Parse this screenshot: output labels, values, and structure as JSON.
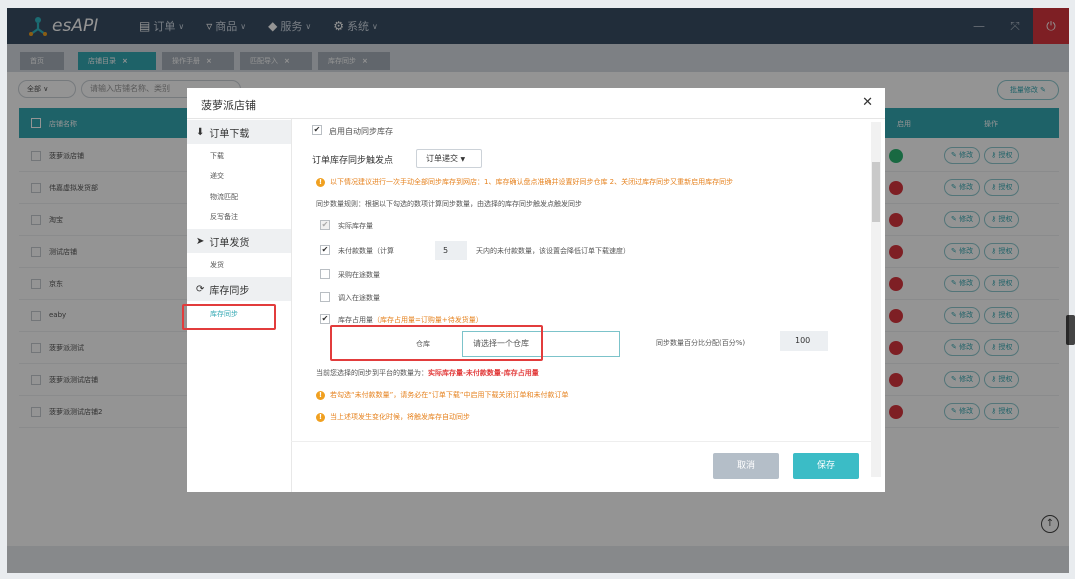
{
  "app": {
    "logo_text": "esAPI"
  },
  "nav": [
    {
      "icon": "clipboard-icon",
      "glyph": "📋",
      "label": "订单"
    },
    {
      "icon": "cart-icon",
      "glyph": "🛒",
      "label": "商品"
    },
    {
      "icon": "shield-icon",
      "glyph": "🛡",
      "label": "服务"
    },
    {
      "icon": "gear-icon",
      "glyph": "⚙",
      "label": "系统"
    }
  ],
  "tabs": [
    {
      "label": "首页",
      "closable": false
    },
    {
      "label": "店铺目录",
      "closable": true,
      "active": true
    },
    {
      "label": "操作手册",
      "closable": true
    },
    {
      "label": "匹配导入",
      "closable": true
    },
    {
      "label": "库存同步",
      "closable": true
    }
  ],
  "filter": {
    "select_value": "全部",
    "search_placeholder": "请输入店铺名称、类别",
    "batch_label": "批量修改"
  },
  "table": {
    "headers": {
      "name": "店铺名称",
      "status": "启用",
      "ops": "操作"
    },
    "rows": [
      {
        "name": "菠萝派店铺",
        "enabled": true
      },
      {
        "name": "伟嘉虚拟发货部",
        "enabled": false
      },
      {
        "name": "淘宝",
        "enabled": false
      },
      {
        "name": "测试店铺",
        "enabled": false
      },
      {
        "name": "京东",
        "enabled": false
      },
      {
        "name": "eaby",
        "enabled": false
      },
      {
        "name": "菠萝派测试",
        "enabled": false
      },
      {
        "name": "菠萝派测试店铺",
        "enabled": false
      },
      {
        "name": "菠萝派测试店铺2",
        "enabled": false
      }
    ],
    "edit_label": "修改",
    "auth_label": "授权"
  },
  "modal": {
    "title": "菠萝派店铺",
    "sections": [
      {
        "icon": "download-icon",
        "glyph": "⬇",
        "label": "订单下载",
        "items": [
          "下载",
          "递交",
          "物流匹配",
          "反写备注"
        ]
      },
      {
        "icon": "send-icon",
        "glyph": "✈",
        "label": "订单发货",
        "items": [
          "发货"
        ]
      },
      {
        "icon": "refresh-icon",
        "glyph": "⟳",
        "label": "库存同步",
        "items": [
          "库存同步"
        ]
      }
    ],
    "form": {
      "enable_label": "启用自动同步库存",
      "trigger_label": "订单库存同步触发点",
      "trigger_value": "订单递交",
      "notice": "以下情况建议进行一次手动全部同步库存到网店：1、库存确认盘点准确并设置好同步仓库 2、关闭过库存同步又重新启用库存同步",
      "rule_text": "同步数量规则：根据以下勾选的数项计算同步数量，由选择的库存同步触发点触发同步",
      "opt_actual": "实际库存量",
      "opt_unpaid_pre": "未付款数量（计算",
      "opt_unpaid_days": "5",
      "opt_unpaid_post": "天内的未付款数量，该设置会降低订单下载速度）",
      "opt_purchase": "采购在途数量",
      "opt_transfer": "调入在途数量",
      "opt_occupy": "库存占用量",
      "opt_occupy_note": "（库存占用量=订购量+待发货量）",
      "warehouse_label": "仓库",
      "warehouse_placeholder": "请选择一个仓库",
      "pct_label": "同步数量百分比分配(百分%)",
      "pct_value": "100",
      "formula_pre": "当前您选择的同步到平台的数量为：",
      "formula": "实际库存量-未付款数量-库存占用量",
      "tip1": "若勾选“未付款数量”，请务必在“订单下载”中启用下载关闭订单和未付款订单",
      "tip2": "当上述项发生变化时候，将触发库存自动同步"
    },
    "cancel_label": "取消",
    "save_label": "保存"
  }
}
